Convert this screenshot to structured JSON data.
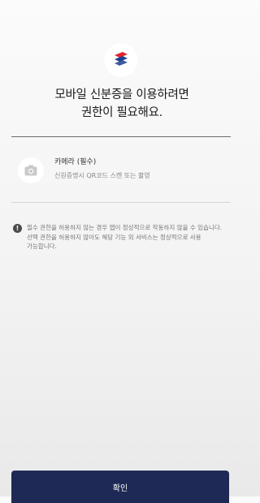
{
  "header": {
    "title_line1": "모바일 신분증을 이용하려면",
    "title_line2": "권한이 필요해요."
  },
  "logo": {
    "icon": "mobile-id-logo-icon",
    "colors": [
      "#1f3f8f",
      "#e0262b"
    ]
  },
  "permissions": [
    {
      "icon": "camera-icon",
      "title": "카메라 (필수)",
      "description": "신원증명시 QR코드 스캔 또는 촬영"
    }
  ],
  "notice": {
    "icon": "exclamation-icon",
    "text": "필수 권한을 허용하지 않는 경우 앱이 정상적으로 작동하지 않을 수 있습니다. 선택 권한을 허용하지 않아도 해당 기능 외 서비스는 정상적으로 사용 가능합니다."
  },
  "footer": {
    "confirm_label": "확인"
  },
  "colors": {
    "button_bg": "#1e2a55",
    "button_text": "#ffffff"
  }
}
